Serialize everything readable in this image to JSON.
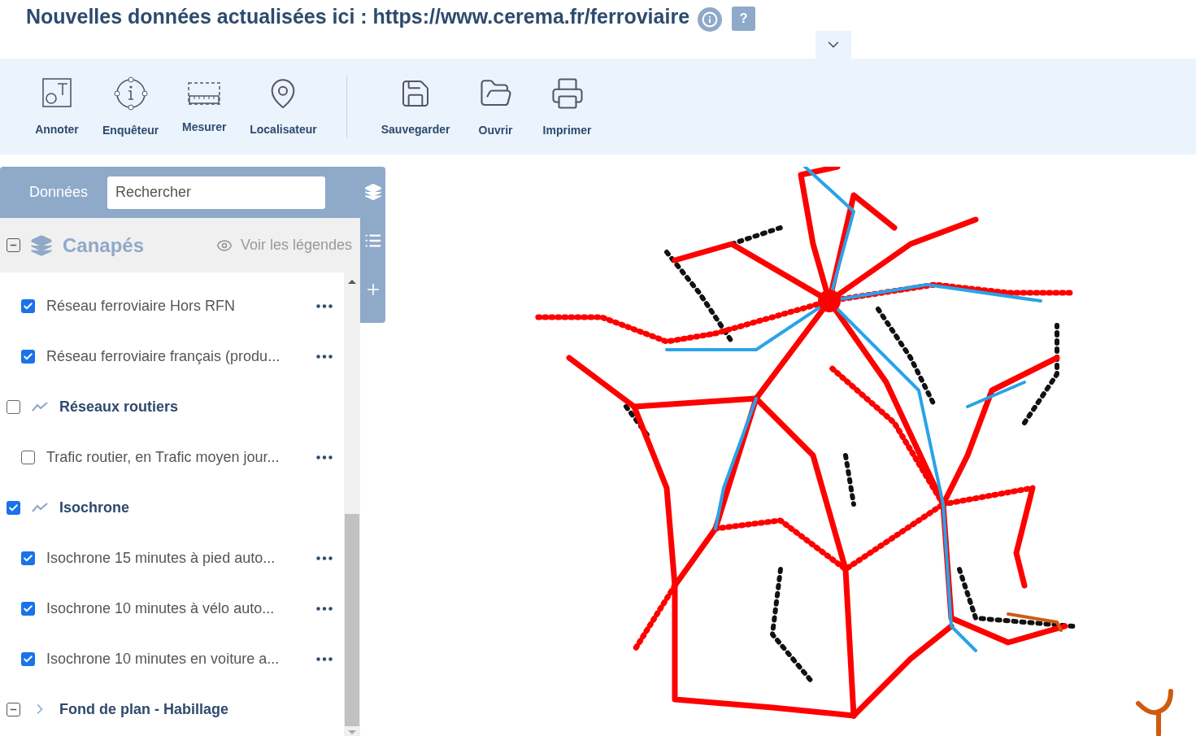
{
  "header": {
    "title": "Nouvelles données actualisées ici : https://www.cerema.fr/ferroviaire",
    "help_label": "?"
  },
  "toolbar": {
    "tools": [
      {
        "label": "Annoter"
      },
      {
        "label": "Enquêteur"
      },
      {
        "label": "Mesurer"
      },
      {
        "label": "Localisateur"
      }
    ],
    "file_tools": [
      {
        "label": "Sauvegarder"
      },
      {
        "label": "Ouvrir"
      },
      {
        "label": "Imprimer"
      }
    ]
  },
  "layers_panel": {
    "tab": "Données",
    "search": {
      "placeholder": "Rechercher"
    },
    "root": {
      "label": "Canapés",
      "expanded": true,
      "legend_link": "Voir les légendes"
    },
    "items": [
      {
        "kind": "layer",
        "label": "Réseau ferroviaire Hors RFN",
        "checked": true
      },
      {
        "kind": "layer",
        "label": "Réseau ferroviaire français (produ...",
        "checked": true
      },
      {
        "kind": "group",
        "label": "Réseaux routiers",
        "checked": false,
        "children": [
          {
            "kind": "layer",
            "label": "Trafic routier, en Trafic moyen jour...",
            "checked": false
          }
        ]
      },
      {
        "kind": "group",
        "label": "Isochrone",
        "checked": true,
        "children": [
          {
            "kind": "layer",
            "label": "Isochrone 15 minutes à pied auto...",
            "checked": true
          },
          {
            "kind": "layer",
            "label": "Isochrone 10 minutes à vélo auto...",
            "checked": true
          },
          {
            "kind": "layer",
            "label": "Isochrone 10 minutes en voiture a...",
            "checked": true
          }
        ]
      },
      {
        "kind": "folder",
        "label": "Fond de plan - Habillage",
        "expanded": false
      }
    ]
  }
}
